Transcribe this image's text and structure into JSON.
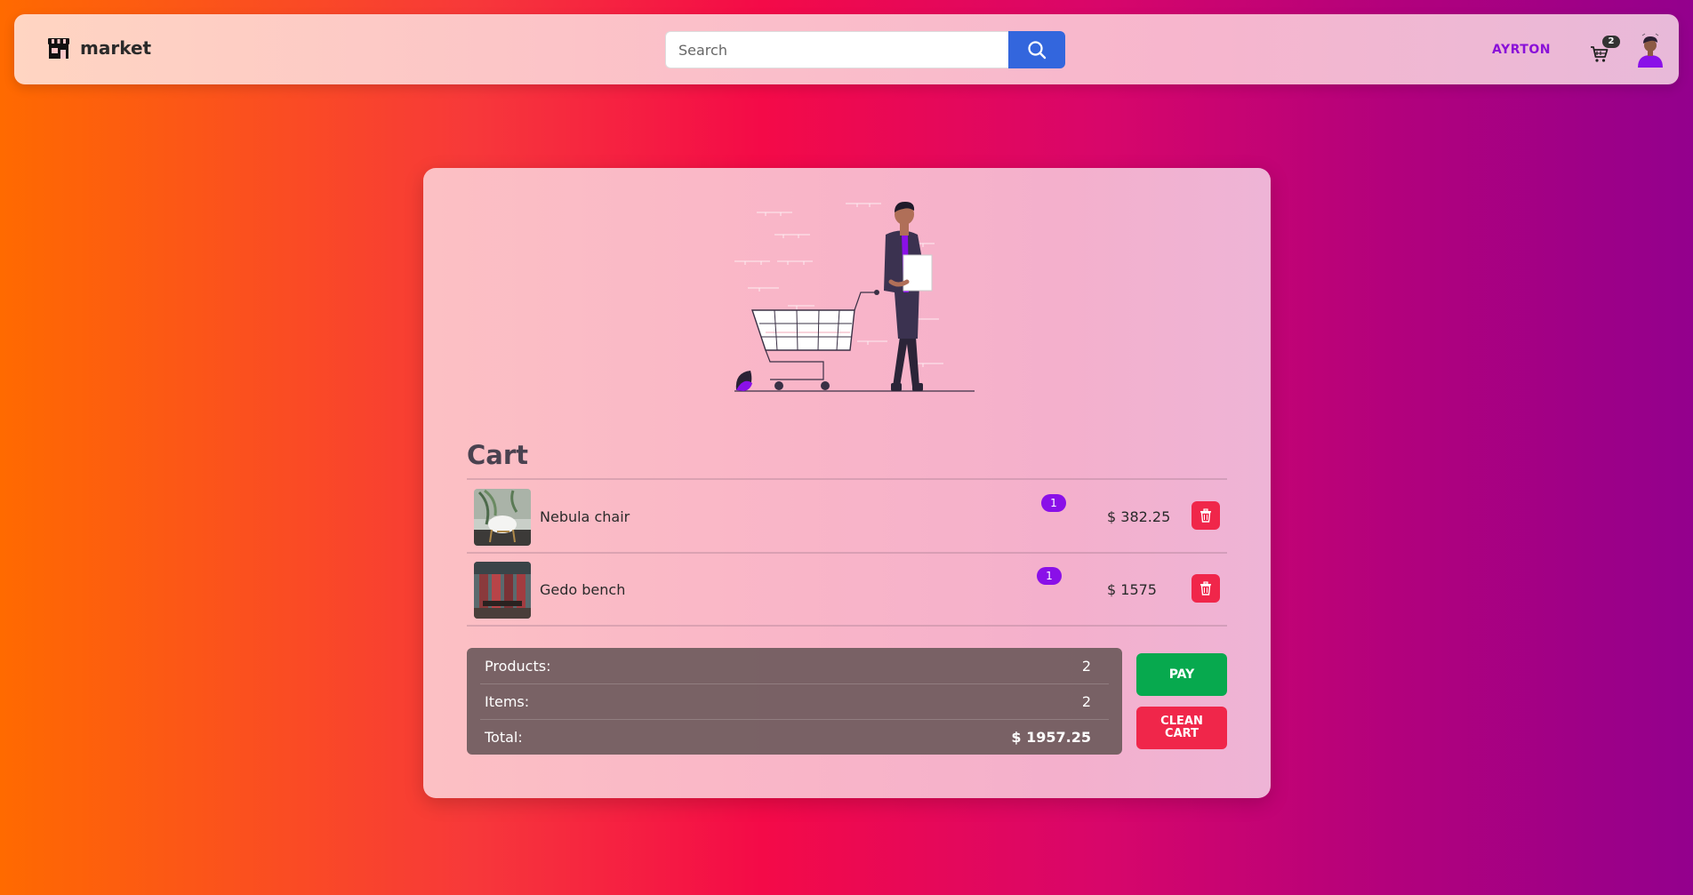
{
  "navbar": {
    "brand": "market",
    "search_placeholder": "Search",
    "user_name": "AYRTON",
    "cart_count": "2"
  },
  "cart": {
    "title": "Cart",
    "items": [
      {
        "name": "Nebula chair",
        "qty": "1",
        "price": "$ 382.25"
      },
      {
        "name": "Gedo bench",
        "qty": "1",
        "price": "$ 1575"
      }
    ],
    "summary": {
      "products_label": "Products:",
      "products_value": "2",
      "items_label": "Items:",
      "items_value": "2",
      "total_label": "Total:",
      "total_value": "$ 1957.25"
    },
    "pay_label": "PAY",
    "clean_label": "CLEAN CART"
  },
  "colors": {
    "accent_purple": "#8a10e8",
    "search_blue": "#3366dd",
    "pay_green": "#07a94e",
    "danger_red": "#f0264a"
  }
}
